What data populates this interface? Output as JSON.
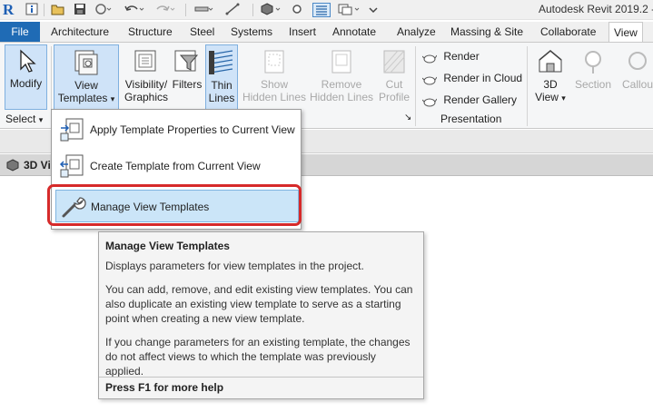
{
  "app": {
    "title": "Autodesk Revit 2019.2 -",
    "logo_letter": "R"
  },
  "quick_access": {
    "icons": [
      "info-icon",
      "open-icon",
      "save-icon",
      "sync-icon",
      "undo-icon",
      "redo-icon",
      "measure-icon",
      "dimension-icon",
      "3d-view-icon",
      "thin-lines-icon",
      "switch-windows-icon",
      "customize-icon"
    ]
  },
  "tabs": [
    {
      "label": "File"
    },
    {
      "label": "Architecture"
    },
    {
      "label": "Structure"
    },
    {
      "label": "Steel"
    },
    {
      "label": "Systems"
    },
    {
      "label": "Insert"
    },
    {
      "label": "Annotate"
    },
    {
      "label": "Analyze"
    },
    {
      "label": "Massing & Site"
    },
    {
      "label": "Collaborate"
    },
    {
      "label": "View"
    }
  ],
  "ribbon": {
    "modify": {
      "label": "Modify"
    },
    "select": {
      "label": "Select",
      "arrow": "▾"
    },
    "view_templates": {
      "line1": "View",
      "line2": "Templates",
      "arrow": "▾"
    },
    "visibility": {
      "line1": "Visibility/",
      "line2": "Graphics"
    },
    "filters": {
      "label": "Filters"
    },
    "thin_lines": {
      "line1": "Thin",
      "line2": "Lines"
    },
    "show_hidden": {
      "line1": "Show",
      "line2": "Hidden Lines"
    },
    "remove_hidden": {
      "line1": "Remove",
      "line2": "Hidden Lines"
    },
    "cut_profile": {
      "line1": "Cut",
      "line2": "Profile"
    },
    "panel_arrow": "↘",
    "render": {
      "label": "Render"
    },
    "render_cloud": {
      "label": "Render  in Cloud"
    },
    "render_gallery": {
      "label": "Render  Gallery"
    },
    "presentation": {
      "label": "Presentation"
    },
    "view3d": {
      "line1": "3D",
      "line2": "View",
      "arrow": "▾"
    },
    "section": {
      "label": "Section"
    },
    "callout": {
      "label": "Callou"
    }
  },
  "view_tab": {
    "label": "3D Vi"
  },
  "dropdown": {
    "items": [
      {
        "label": "Apply Template Properties to Current View"
      },
      {
        "label": "Create Template from Current View"
      },
      {
        "label": "Manage View Templates"
      }
    ]
  },
  "tooltip": {
    "title": "Manage View Templates",
    "p1": "Displays parameters for view templates in the project.",
    "p2": "You can add, remove, and edit existing view templates. You can also duplicate an existing view template to serve as a starting point when creating a new view template.",
    "p3": "If you change parameters for an existing template, the changes do not affect views to which the template was previously applied.",
    "help": "Press F1 for more help"
  },
  "colors": {
    "file_tab": "#1f6bb5",
    "highlight": "#cbe5f8",
    "annotation_ring": "#d62a2a"
  }
}
